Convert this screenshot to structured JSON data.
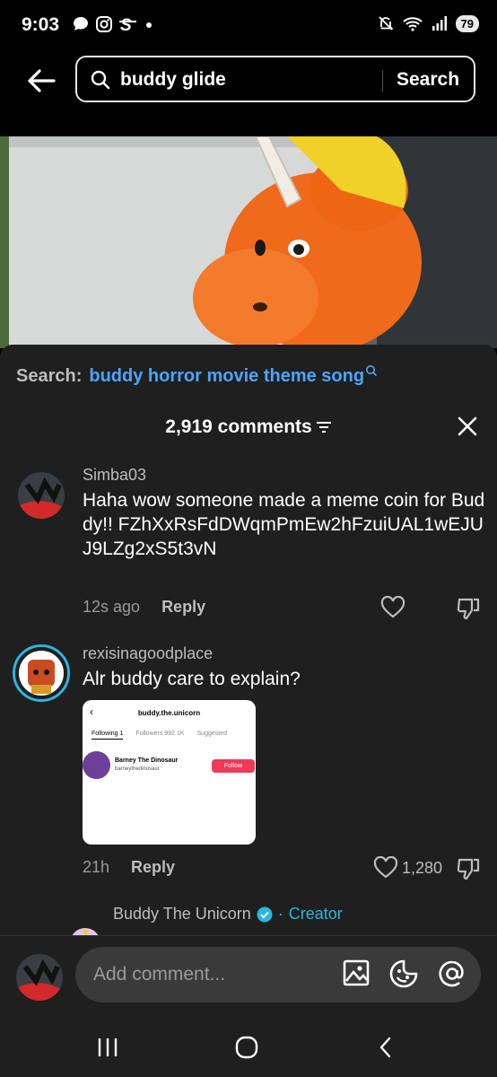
{
  "status_bar": {
    "time": "9:03",
    "battery": "79",
    "left_icons": [
      "chat-icon",
      "instagram-icon",
      "s-app-icon",
      "dot-icon"
    ],
    "right_icons": [
      "mute-icon",
      "wifi-icon",
      "signal-icon",
      "battery-icon"
    ]
  },
  "search": {
    "query": "buddy glide",
    "submit_label": "Search"
  },
  "comments_panel": {
    "suggestion_label": "Search:",
    "suggestion_term": "buddy horror movie theme song",
    "count_label": "2,919 comments",
    "comments": [
      {
        "user": "Simba03",
        "text": "Haha wow someone made a meme coin for Buddy!! FZhXxRsFdDWqmPmEw2hFzuiUAL1wEJUJ9LZg2xS5t3vN",
        "time": "12s ago",
        "reply_label": "Reply",
        "likes": ""
      },
      {
        "user": "rexisinagoodplace",
        "text": "Alr buddy care to explain?",
        "time": "21h",
        "reply_label": "Reply",
        "likes": "1,280"
      }
    ],
    "embedded_screenshot": {
      "title": "buddy.the.unicorn",
      "tabs": [
        "Following 1",
        "Followers 992.1K",
        "Suggested"
      ],
      "account_name": "Barney The Dinosaur",
      "account_handle": "barneythedinosaur",
      "follow_label": "Follow"
    },
    "reply": {
      "user": "Buddy The Unicorn",
      "separator": "·",
      "badge": "Creator"
    }
  },
  "composer": {
    "placeholder": "Add comment..."
  },
  "colors": {
    "accent_link": "#4aa6ff",
    "creator": "#2bb6e0",
    "follow": "#ee3a58",
    "sheet_bg": "#1f1f1f"
  }
}
